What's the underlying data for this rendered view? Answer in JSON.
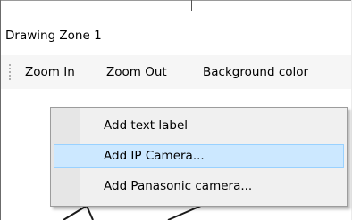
{
  "zone": {
    "title": "Drawing Zone 1"
  },
  "toolbar": {
    "items": [
      {
        "label": "Zoom In"
      },
      {
        "label": "Zoom Out"
      },
      {
        "label": "Background color"
      }
    ]
  },
  "context_menu": {
    "items": [
      {
        "label": "Add text label",
        "highlighted": false
      },
      {
        "label": "Add IP Camera...",
        "highlighted": true
      },
      {
        "label": "Add Panasonic camera...",
        "highlighted": false
      }
    ]
  },
  "colors": {
    "menu_background": "#f0f0f0",
    "highlight_fill": "#cce8ff",
    "highlight_border": "#99d1ff"
  }
}
